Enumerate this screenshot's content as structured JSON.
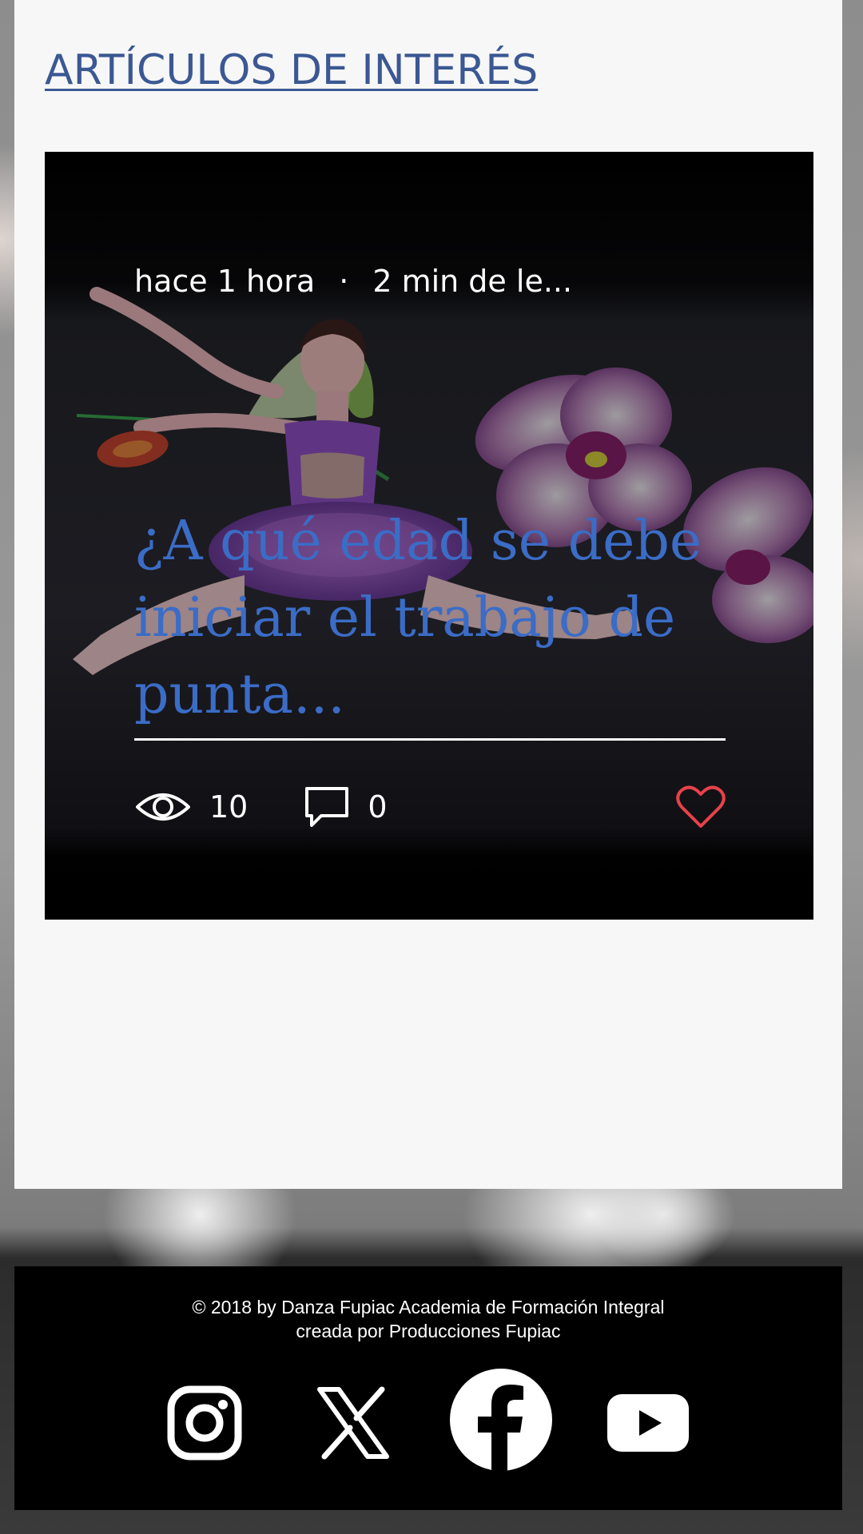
{
  "section": {
    "title": "ARTÍCULOS DE INTERÉS"
  },
  "post": {
    "time_ago": "hace 1 hora",
    "separator": "·",
    "read_time": "2 min de le...",
    "title": "¿A qué edad se debe iniciar el trabajo de punta...",
    "views": "10",
    "comments": "0",
    "liked": false,
    "icons": {
      "views": "eye-icon",
      "comments": "comment-icon",
      "like": "heart-icon"
    },
    "colors": {
      "title": "#3b6cc6",
      "like": "#e8414b"
    }
  },
  "footer": {
    "copyright_line1": "© 2018 by Danza Fupiac Academia de Formación Integral",
    "copyright_line2": "creada por Producciones Fupiac",
    "social": [
      "instagram-icon",
      "x-icon",
      "facebook-icon",
      "youtube-icon"
    ]
  },
  "colors": {
    "section_title": "#3b5893",
    "panel_background": "#f7f7f8",
    "footer_background": "#000000"
  }
}
